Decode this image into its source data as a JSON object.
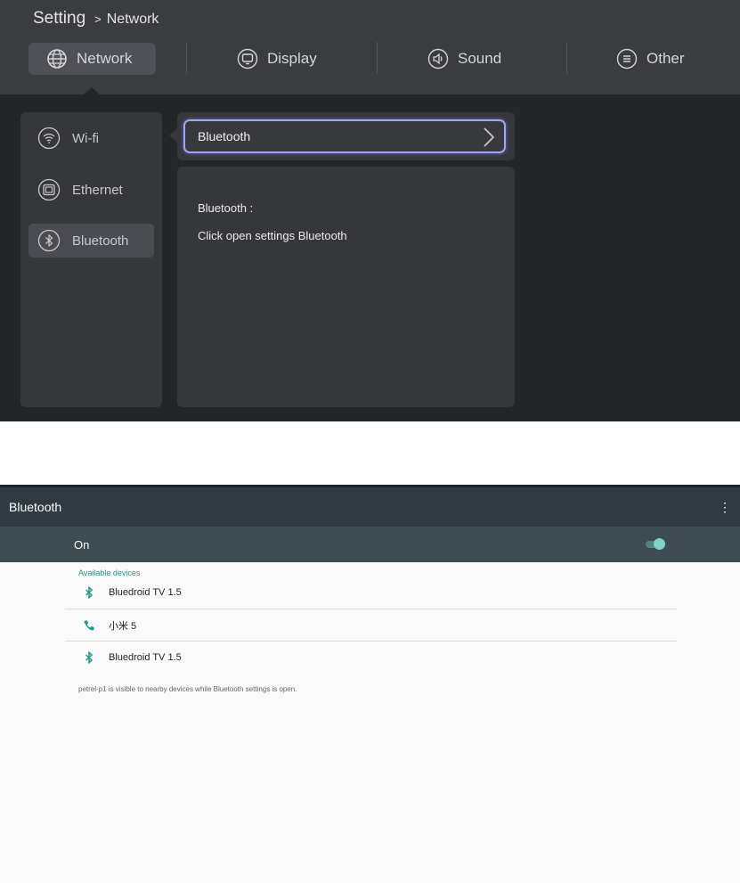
{
  "tv": {
    "breadcrumb": {
      "root": "Setting",
      "separator": ">",
      "current": "Network"
    },
    "tabs": [
      {
        "label": "Network",
        "icon": "globe-icon",
        "active": true
      },
      {
        "label": "Display",
        "icon": "display-icon",
        "active": false
      },
      {
        "label": "Sound",
        "icon": "speaker-icon",
        "active": false
      },
      {
        "label": "Other",
        "icon": "menu-circle-icon",
        "active": false
      }
    ],
    "sidebar": [
      {
        "label": "Wi-fi",
        "icon": "wifi-icon",
        "active": false
      },
      {
        "label": "Ethernet",
        "icon": "ethernet-icon",
        "active": false
      },
      {
        "label": "Bluetooth",
        "icon": "bluetooth-icon",
        "active": true
      }
    ],
    "selected_row": {
      "label": "Bluetooth",
      "icon": "chevron-right-icon"
    },
    "info": {
      "title": "Bluetooth :",
      "description": "Click open settings Bluetooth"
    }
  },
  "android": {
    "title": "Bluetooth",
    "menu_icon": "⋮",
    "toggle": {
      "label": "On",
      "state": true,
      "accent": "#7fd3c4"
    },
    "section_label": "Available devices",
    "devices": [
      {
        "name": "Bluedroid TV 1.5",
        "icon": "bluetooth-icon"
      },
      {
        "name": "小米 5",
        "icon": "phone-icon"
      },
      {
        "name": "Bluedroid TV 1.5",
        "icon": "bluetooth-icon"
      }
    ],
    "visibility_note": "petrel-p1 is visible to nearby devices while Bluetooth settings is open."
  },
  "colors": {
    "tv_background": "#252628",
    "tv_header": "#3b3c40",
    "focus_border": "#9ea6f2",
    "android_bar": "#2f3b40",
    "android_on_bar": "#3d4c52",
    "android_accent": "#1f9a8a"
  }
}
